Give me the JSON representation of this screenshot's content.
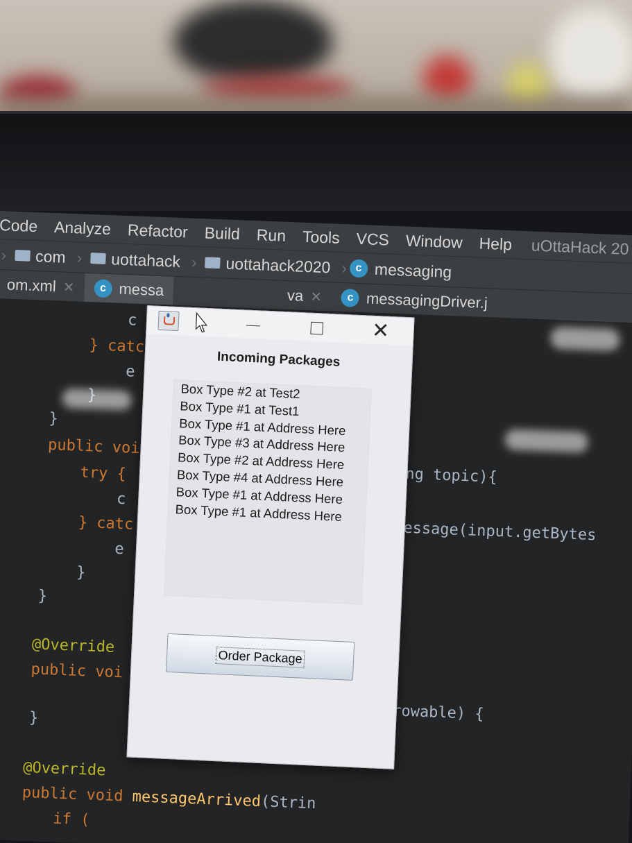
{
  "ide": {
    "menu": [
      "Code",
      "Analyze",
      "Refactor",
      "Build",
      "Run",
      "Tools",
      "VCS",
      "Window",
      "Help"
    ],
    "app_title": "uOttaHack 20",
    "breadcrumb": [
      "com",
      "uottahack",
      "uottahack2020",
      "messaging"
    ],
    "tabs": [
      {
        "label": "om.xml"
      },
      {
        "label": "messa"
      },
      {
        "label": "va"
      },
      {
        "label": "messagingDriver.j"
      }
    ],
    "code_fragments": {
      "l1": "c",
      "l2_kw": "} catc",
      "l3": "e",
      "l4": "}",
      "l5": "}",
      "l6_kw": "public voi",
      "l6_tail": "ring topic){",
      "l7_kw": "try {",
      "l8": "c",
      "l8_tail": "tMessage(input.getBytes",
      "l9_kw": "} catc",
      "l10": "e",
      "l11": "}",
      "l12": "}",
      "l13_ann": "@Override",
      "l14_kw": "public voi",
      "l14_tail": "throwable) {",
      "l15": "}",
      "l16_ann": "@Override",
      "l17_kw": "public void",
      "l17_fn": "messageArrived",
      "l17_tail": "(Strin",
      "l18_kw": "if ("
    }
  },
  "popup": {
    "heading": "Incoming Packages",
    "packages": [
      "Box Type #2 at Test2",
      "Box Type #1 at Test1",
      "Box Type #1 at Address Here",
      "Box Type #3 at Address Here",
      "Box Type #2 at Address Here",
      "Box Type #4 at Address Here",
      "Box Type #1 at Address Here",
      "Box Type #1 at Address Here"
    ],
    "order_button": "Order Package",
    "icons": [
      "java-icon",
      "cursor-icon",
      "minimize-icon",
      "maximize-icon",
      "close-icon"
    ]
  },
  "colors": {
    "ide_bg": "#2b2b2b",
    "keyword": "#cc7832",
    "annotation": "#bbb529",
    "class_icon": "#3592c4",
    "popup_bg": "#e9ebee"
  }
}
